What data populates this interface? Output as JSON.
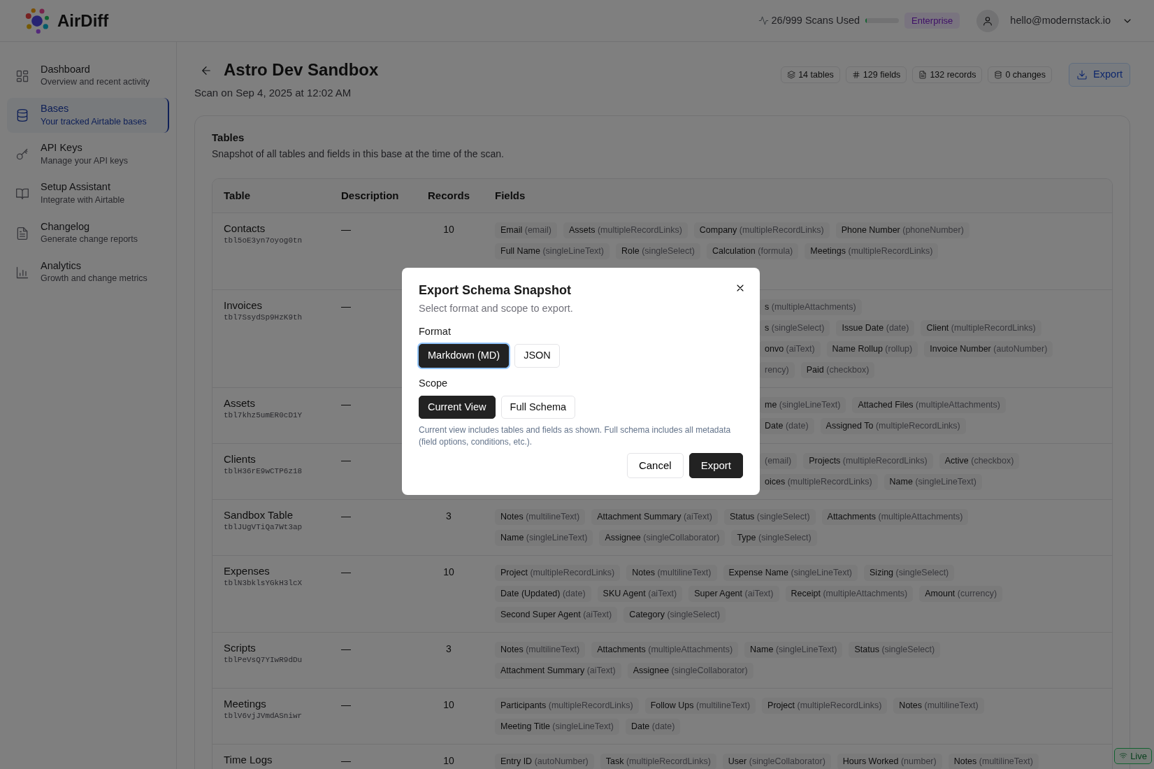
{
  "app": {
    "name": "AirDiff"
  },
  "header": {
    "usage": {
      "text": "26/999 Scans Used",
      "level": 0.03
    },
    "plan": "Enterprise",
    "email": "hello@modernstack.io"
  },
  "sidebar": {
    "items": [
      {
        "label": "Dashboard",
        "sub": "Overview and recent activity",
        "selected": false
      },
      {
        "label": "Bases",
        "sub": "Your tracked Airtable bases",
        "selected": true
      },
      {
        "label": "API Keys",
        "sub": "Manage your API keys",
        "selected": false
      },
      {
        "label": "Setup Assistant",
        "sub": "Integrate with Airtable",
        "selected": false
      },
      {
        "label": "Changelog",
        "sub": "Generate change reports",
        "selected": false
      },
      {
        "label": "Analytics",
        "sub": "Growth and change metrics",
        "selected": false
      }
    ]
  },
  "page": {
    "title": "Astro Dev Sandbox",
    "subtitle": "Scan on Sep 4, 2025 at 12:02 AM",
    "stats": [
      {
        "text": "14 tables"
      },
      {
        "text": "129 fields"
      },
      {
        "text": "132 records"
      },
      {
        "text": "0 changes"
      }
    ],
    "export_button": "Export"
  },
  "tables_card": {
    "title": "Tables",
    "subtitle": "Snapshot of all tables and fields in this base at the time of the scan.",
    "columns": [
      "Table",
      "Description",
      "Records",
      "Fields"
    ],
    "rows": [
      {
        "name": "Contacts",
        "id": "tbl5oE3yn7oyog0tn",
        "description": "—",
        "records": "10",
        "field_lines": [
          [
            {
              "name": "Email",
              "type": "(email)"
            },
            {
              "name": "Assets",
              "type": "(multipleRecordLinks)"
            },
            {
              "name": "Company",
              "type": "(multipleRecordLinks)"
            },
            {
              "name": "Phone Number",
              "type": "(phoneNumber)"
            }
          ],
          [
            {
              "name": "Full Name",
              "type": "(singleLineText)"
            },
            {
              "name": "Role",
              "type": "(singleSelect)"
            },
            {
              "name": "Calculation",
              "type": "(formula)"
            },
            {
              "name": "Meetings",
              "type": "(multipleRecordLinks)"
            }
          ]
        ]
      },
      {
        "name": "Invoices",
        "id": "tbl7SsydSp9HzK9th",
        "description": "—",
        "field_lines": [
          [
            {
              "name": "s",
              "type": "(multipleAttachments)"
            }
          ],
          [
            {
              "name": "s",
              "type": "(singleSelect)"
            },
            {
              "name": "Issue Date",
              "type": "(date)"
            },
            {
              "name": "Client",
              "type": "(multipleRecordLinks)"
            }
          ],
          [
            {
              "name": "onvo",
              "type": "(aiText)"
            },
            {
              "name": "Name Rollup",
              "type": "(rollup)"
            },
            {
              "name": "Invoice Number",
              "type": "(autoNumber)"
            }
          ],
          [
            {
              "type": "rency)"
            },
            {
              "name": "Paid",
              "type": "(checkbox)"
            }
          ]
        ]
      },
      {
        "name": "Assets",
        "id": "tbl7khz5umER0cD1Y",
        "description": "—",
        "field_lines": [
          [
            {
              "name": "me",
              "type": "(singleLineText)"
            },
            {
              "name": "Attached Files",
              "type": "(multipleAttachments)"
            }
          ],
          [
            {
              "name": "Date",
              "type": "(date)"
            },
            {
              "name": "Assigned To",
              "type": "(multipleRecordLinks)"
            }
          ]
        ]
      },
      {
        "name": "Clients",
        "id": "tblH36rE9wCTP6z18",
        "description": "—",
        "field_lines": [
          [
            {
              "type": "(email)"
            },
            {
              "name": "Projects",
              "type": "(multipleRecordLinks)"
            },
            {
              "name": "Active",
              "type": "(checkbox)"
            }
          ],
          [
            {
              "name": "oices",
              "type": "(multipleRecordLinks)"
            },
            {
              "name": "Name",
              "type": "(singleLineText)"
            }
          ]
        ]
      },
      {
        "name": "Sandbox Table",
        "id": "tblJUgVTiQa7Wt3ap",
        "description": "—",
        "records": "3",
        "field_lines": [
          [
            {
              "name": "Notes",
              "type": "(multilineText)"
            },
            {
              "name": "Attachment Summary",
              "type": "(aiText)"
            },
            {
              "name": "Status",
              "type": "(singleSelect)"
            },
            {
              "name": "Attachments",
              "type": "(multipleAttachments)"
            }
          ],
          [
            {
              "name": "Name",
              "type": "(singleLineText)"
            },
            {
              "name": "Assignee",
              "type": "(singleCollaborator)"
            },
            {
              "name": "Type",
              "type": "(singleSelect)"
            }
          ]
        ]
      },
      {
        "name": "Expenses",
        "id": "tblN3bklsYGkH3lcX",
        "description": "—",
        "records": "10",
        "field_lines": [
          [
            {
              "name": "Project",
              "type": "(multipleRecordLinks)"
            },
            {
              "name": "Notes",
              "type": "(multilineText)"
            },
            {
              "name": "Expense Name",
              "type": "(singleLineText)"
            },
            {
              "name": "Sizing",
              "type": "(singleSelect)"
            }
          ],
          [
            {
              "name": "Date (Updated)",
              "type": "(date)"
            },
            {
              "name": "SKU Agent",
              "type": "(aiText)"
            },
            {
              "name": "Super Agent",
              "type": "(aiText)"
            },
            {
              "name": "Receipt",
              "type": "(multipleAttachments)"
            },
            {
              "name": "Amount",
              "type": "(currency)"
            }
          ],
          [
            {
              "name": "Second Super Agent",
              "type": "(aiText)"
            },
            {
              "name": "Category",
              "type": "(singleSelect)"
            }
          ]
        ]
      },
      {
        "name": "Scripts",
        "id": "tblPeVsQ7YIwR9dDu",
        "description": "—",
        "records": "3",
        "field_lines": [
          [
            {
              "name": "Notes",
              "type": "(multilineText)"
            },
            {
              "name": "Attachments",
              "type": "(multipleAttachments)"
            },
            {
              "name": "Name",
              "type": "(singleLineText)"
            },
            {
              "name": "Status",
              "type": "(singleSelect)"
            }
          ],
          [
            {
              "name": "Attachment Summary",
              "type": "(aiText)"
            },
            {
              "name": "Assignee",
              "type": "(singleCollaborator)"
            }
          ]
        ]
      },
      {
        "name": "Meetings",
        "id": "tblV6vjJVmdASniwr",
        "description": "—",
        "records": "10",
        "field_lines": [
          [
            {
              "name": "Participants",
              "type": "(multipleRecordLinks)"
            },
            {
              "name": "Follow Ups",
              "type": "(multilineText)"
            },
            {
              "name": "Project",
              "type": "(multipleRecordLinks)"
            },
            {
              "name": "Notes",
              "type": "(multilineText)"
            }
          ],
          [
            {
              "name": "Meeting Title",
              "type": "(singleLineText)"
            },
            {
              "name": "Date",
              "type": "(date)"
            }
          ]
        ]
      },
      {
        "name": "Time Logs",
        "description": "—",
        "records": "10",
        "field_lines": [
          [
            {
              "name": "Entry ID",
              "type": "(autoNumber)"
            },
            {
              "name": "Task",
              "type": "(multipleRecordLinks)"
            },
            {
              "name": "User",
              "type": "(singleCollaborator)"
            },
            {
              "name": "Hours Worked",
              "type": "(number)"
            },
            {
              "name": "Notes",
              "type": "(multilineText)"
            }
          ]
        ]
      }
    ]
  },
  "live_badge": "Live",
  "dialog": {
    "title": "Export Schema Snapshot",
    "subtitle": "Select format and scope to export.",
    "format_label": "Format",
    "formats": [
      {
        "label": "Markdown (MD)",
        "selected": true
      },
      {
        "label": "JSON",
        "selected": false
      }
    ],
    "scope_label": "Scope",
    "scopes": [
      {
        "label": "Current View",
        "selected": true
      },
      {
        "label": "Full Schema",
        "selected": false
      }
    ],
    "help": "Current view includes tables and fields as shown. Full schema includes all metadata (field options, conditions, etc.).",
    "buttons": [
      {
        "label": "Cancel",
        "kind": "secondary"
      },
      {
        "label": "Export",
        "kind": "primary"
      }
    ]
  }
}
